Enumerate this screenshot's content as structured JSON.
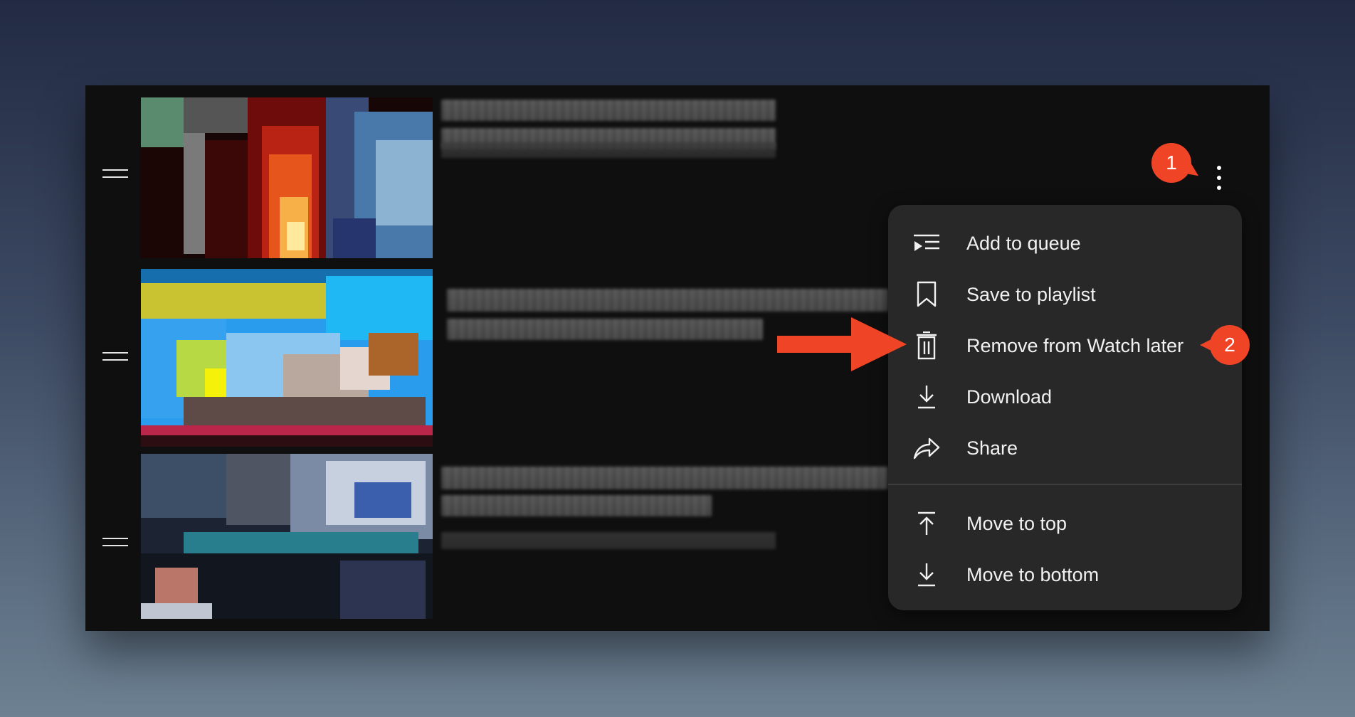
{
  "playlist": {
    "rows": [
      {
        "handle_icon": "drag-handle-icon"
      },
      {
        "handle_icon": "drag-handle-icon"
      },
      {
        "handle_icon": "drag-handle-icon"
      }
    ]
  },
  "more_actions": {
    "icon": "kebab-vertical-icon"
  },
  "menu": {
    "items": [
      {
        "label": "Add to queue",
        "icon": "add-to-queue-icon"
      },
      {
        "label": "Save to playlist",
        "icon": "bookmark-icon"
      },
      {
        "label": "Remove from Watch later",
        "icon": "trash-icon"
      },
      {
        "label": "Download",
        "icon": "download-icon"
      },
      {
        "label": "Share",
        "icon": "share-icon"
      },
      {
        "label": "Move to top",
        "icon": "move-to-top-icon"
      },
      {
        "label": "Move to bottom",
        "icon": "move-to-bottom-icon"
      }
    ]
  },
  "annotations": {
    "step1": "1",
    "step2": "2",
    "accent": "#f04427"
  }
}
